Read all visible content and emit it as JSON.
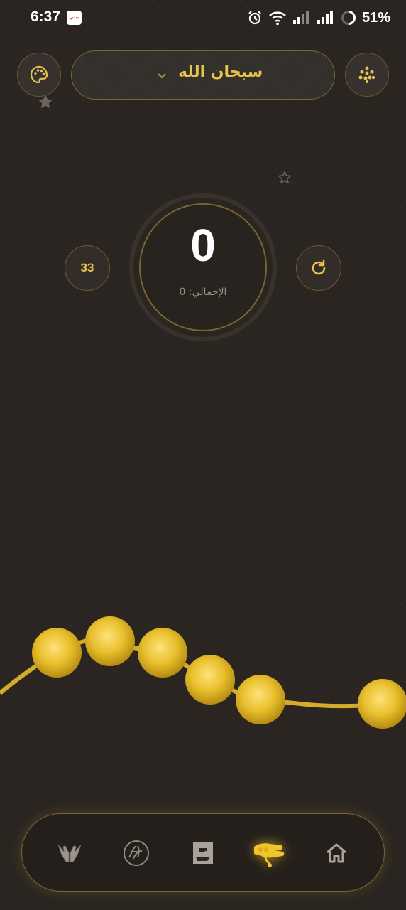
{
  "status_bar": {
    "time": "6:37",
    "app_badge": "بيتي",
    "battery": "51%",
    "icons": [
      "alarm-icon",
      "wifi-icon",
      "signal-icon",
      "signal-icon",
      "battery-ring-icon"
    ]
  },
  "header": {
    "dhikr": "سبحان الله",
    "left_button_icon": "palette-icon",
    "right_button_icon": "beads-grid-icon"
  },
  "counter": {
    "count": "0",
    "total_label": "الإجمالي: 0",
    "target": "33",
    "reset_icon": "refresh-icon"
  },
  "tasbih": {
    "beads_visible": 6,
    "bead_color": "#e8bf2c"
  },
  "bottom_nav": {
    "items": [
      {
        "id": "duas",
        "icon": "praying-hands-icon",
        "active": false
      },
      {
        "id": "quran",
        "icon": "quran-calligraphy-icon",
        "active": false
      },
      {
        "id": "qibla",
        "icon": "kaaba-icon",
        "active": false
      },
      {
        "id": "tasbih",
        "icon": "tasbih-hand-icon",
        "active": true
      },
      {
        "id": "home",
        "icon": "home-icon",
        "active": false
      }
    ]
  },
  "colors": {
    "background": "#2a2521",
    "accent": "#e6c34a",
    "text_primary": "#ffffff",
    "text_muted": "#9a938a"
  }
}
